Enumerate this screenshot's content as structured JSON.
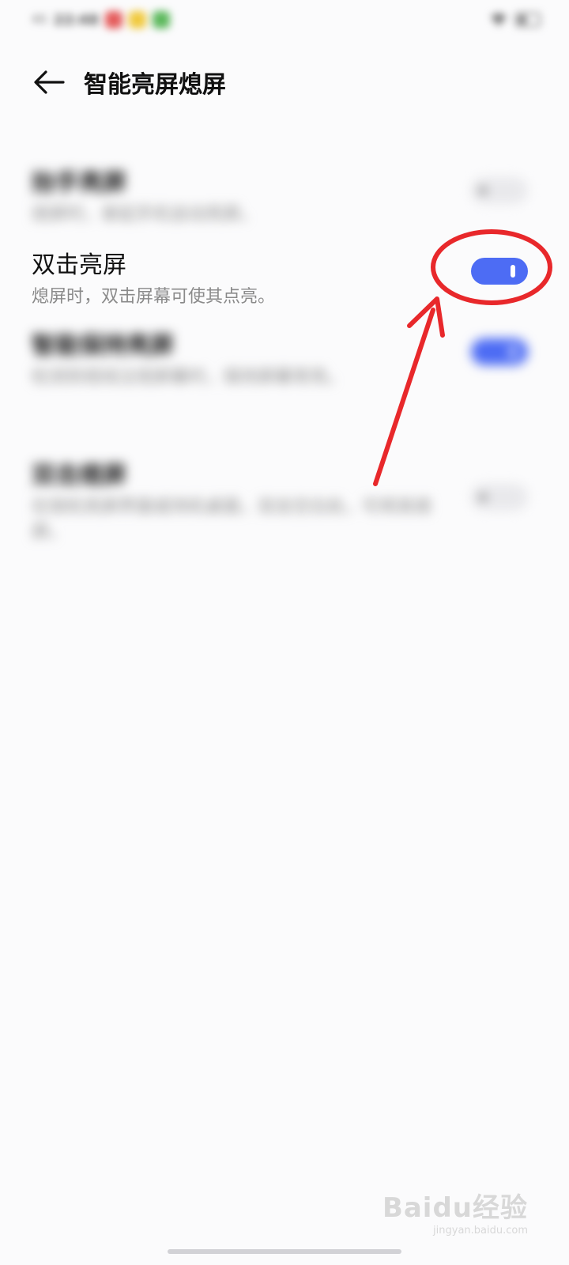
{
  "status_bar": {
    "signal": "4G",
    "time": "22:48",
    "notification_colors": [
      "#e45b5b",
      "#f0c93e",
      "#5cb85c"
    ]
  },
  "header": {
    "title": "智能亮屏熄屏"
  },
  "settings": [
    {
      "title": "抬手亮屏",
      "subtitle": "熄屏时，拿起手机自动亮屏。",
      "enabled": false
    },
    {
      "title": "双击亮屏",
      "subtitle": "熄屏时，双击屏幕可使其点亮。",
      "enabled": true
    },
    {
      "title": "智能保持亮屏",
      "subtitle": "检测到视线注视屏幕时，保持屏幕常亮。",
      "enabled": true
    },
    {
      "title": "双击熄屏",
      "subtitle": "在锁机亮屏界面或待机桌面，双击空白处，可将其熄屏。",
      "enabled": false
    }
  ],
  "colors": {
    "accent": "#4d6cf4",
    "annotation": "#e8282b"
  },
  "watermark": {
    "logo": "Baidu经验",
    "url": "jingyan.baidu.com"
  }
}
